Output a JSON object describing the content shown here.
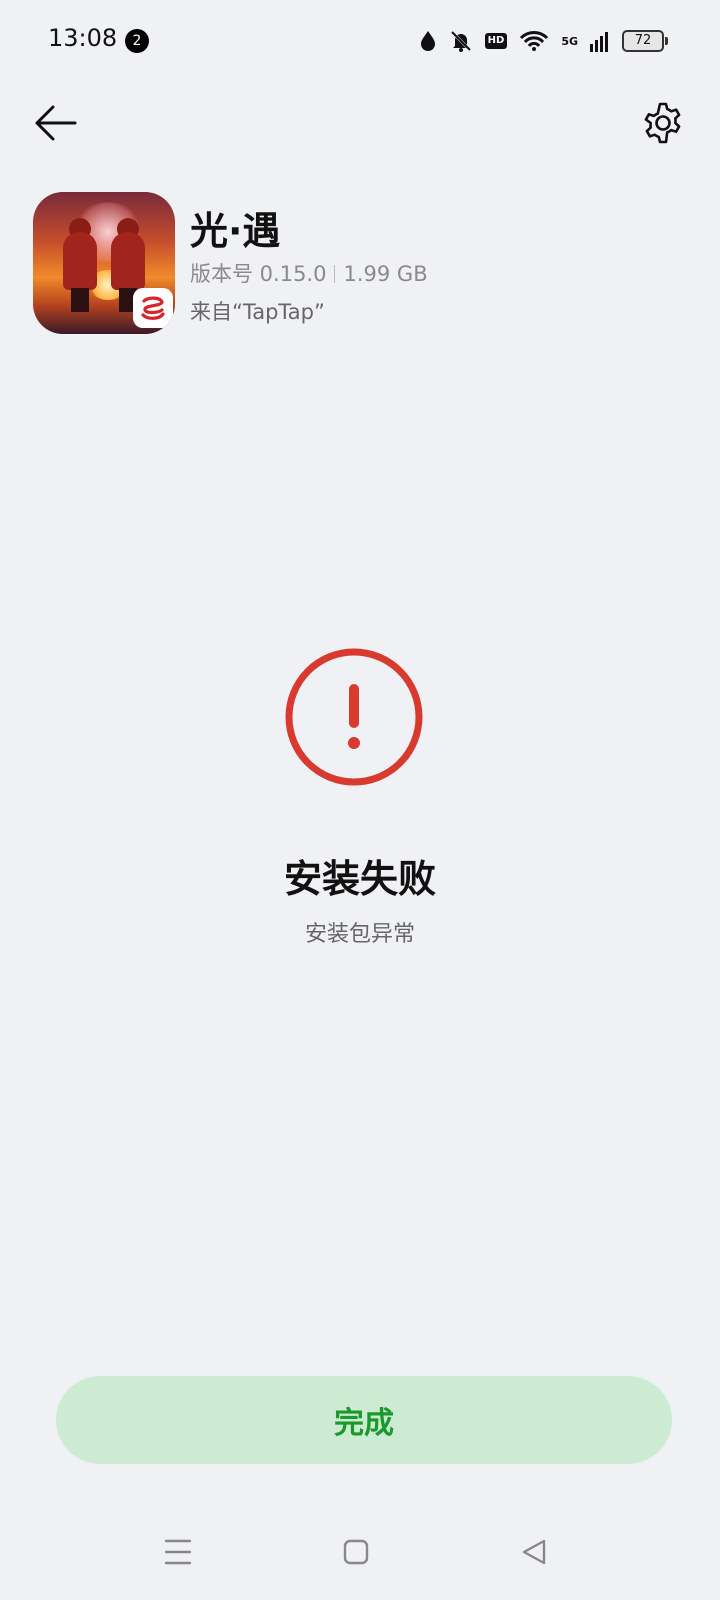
{
  "status_bar": {
    "time": "13:08",
    "notification_count": "2",
    "hd_label": "HD",
    "network": "5G",
    "battery": "72"
  },
  "app": {
    "name": "光·遇",
    "version": "版本号 0.15.0",
    "size": "1.99 GB",
    "source": "来自“TapTap”"
  },
  "install": {
    "status_title": "安装失败",
    "status_reason": "安装包异常"
  },
  "actions": {
    "done_label": "完成"
  },
  "colors": {
    "background": "#f0f1f4",
    "error": "#d93a2f",
    "done_button_bg": "#cdebd2",
    "done_button_text": "#1a9a2a"
  },
  "icons": [
    "back-arrow-icon",
    "gear-icon",
    "error-icon",
    "menu-icon",
    "home-icon",
    "back-triangle-icon"
  ]
}
